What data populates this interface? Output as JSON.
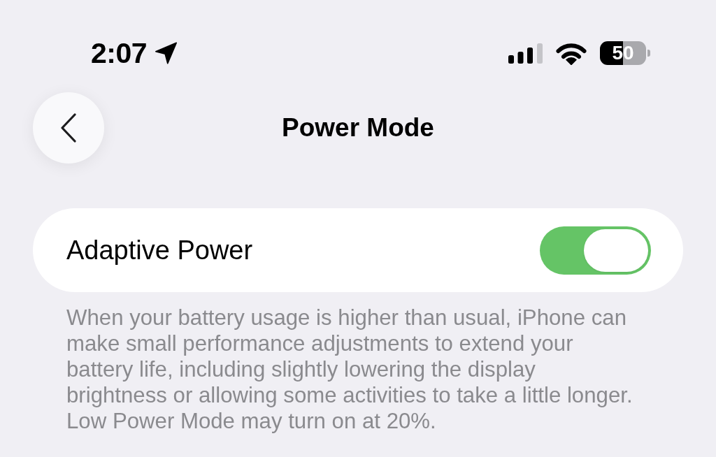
{
  "status_bar": {
    "time": "2:07",
    "battery": "50"
  },
  "nav": {
    "title": "Power Mode"
  },
  "adaptive_power": {
    "label": "Adaptive Power",
    "on": true
  },
  "footer_note": {
    "lines": [
      "When your battery usage is higher than usual, iPhone can",
      "make small performance adjustments to extend your",
      "battery life, including slightly lowering the display",
      "brightness or allowing some activities to take a little longer.",
      "Low Power Mode may turn on at 20%."
    ]
  }
}
